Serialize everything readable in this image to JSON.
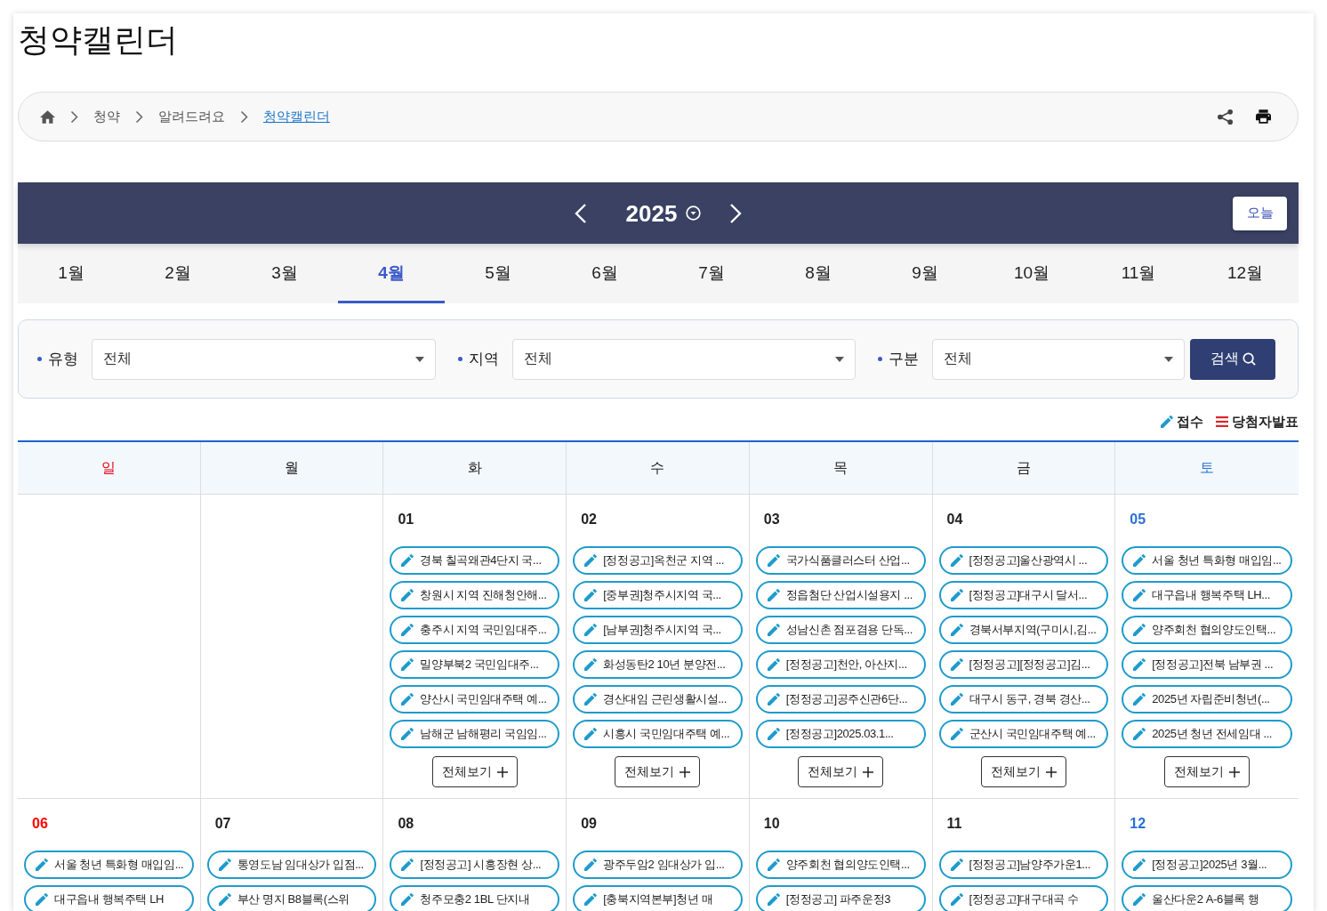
{
  "page_title": "청약캘린더",
  "breadcrumb": [
    {
      "label": "청약",
      "current": false
    },
    {
      "label": "알려드려요",
      "current": false
    },
    {
      "label": "청약캘린더",
      "current": true
    }
  ],
  "calendar_header": {
    "year": "2025",
    "today_button": "오늘"
  },
  "months": [
    {
      "label": "1월",
      "selected": false
    },
    {
      "label": "2월",
      "selected": false
    },
    {
      "label": "3월",
      "selected": false
    },
    {
      "label": "4월",
      "selected": true
    },
    {
      "label": "5월",
      "selected": false
    },
    {
      "label": "6월",
      "selected": false
    },
    {
      "label": "7월",
      "selected": false
    },
    {
      "label": "8월",
      "selected": false
    },
    {
      "label": "9월",
      "selected": false
    },
    {
      "label": "10월",
      "selected": false
    },
    {
      "label": "11월",
      "selected": false
    },
    {
      "label": "12월",
      "selected": false
    }
  ],
  "filters": [
    {
      "label": "유형",
      "value": "전체"
    },
    {
      "label": "지역",
      "value": "전체"
    },
    {
      "label": "구분",
      "value": "전체"
    }
  ],
  "search_button": "검색",
  "legend": [
    {
      "kind": "receipt",
      "label": "접수"
    },
    {
      "kind": "announcement",
      "label": "당첨자발표"
    }
  ],
  "weekdays": [
    {
      "label": "일",
      "kind": "sunday"
    },
    {
      "label": "월",
      "kind": "weekday"
    },
    {
      "label": "화",
      "kind": "weekday"
    },
    {
      "label": "수",
      "kind": "weekday"
    },
    {
      "label": "목",
      "kind": "weekday"
    },
    {
      "label": "금",
      "kind": "weekday"
    },
    {
      "label": "토",
      "kind": "saturday"
    }
  ],
  "weeks": [
    {
      "days": [
        {
          "kind": "empty"
        },
        {
          "kind": "empty"
        },
        {
          "date": "01",
          "kind": "weekday",
          "events": [
            {
              "kind": "receipt",
              "title": "경북 칠곡왜관4단지 국..."
            },
            {
              "kind": "receipt",
              "title": "창원시 지역 진해청안해..."
            },
            {
              "kind": "receipt",
              "title": "충주시 지역 국민임대주..."
            },
            {
              "kind": "receipt",
              "title": "밀양부북2 국민임대주..."
            },
            {
              "kind": "receipt",
              "title": "양산시 국민임대주택 예..."
            },
            {
              "kind": "receipt",
              "title": "남해군 남해평리 국임임..."
            }
          ],
          "more_button": "전체보기"
        },
        {
          "date": "02",
          "kind": "weekday",
          "events": [
            {
              "kind": "receipt",
              "title": "[정정공고]옥천군 지역 ..."
            },
            {
              "kind": "receipt",
              "title": "[중부권]청주시지역 국..."
            },
            {
              "kind": "receipt",
              "title": "[남부권]청주시지역 국..."
            },
            {
              "kind": "receipt",
              "title": "화성동탄2 10년 분양전..."
            },
            {
              "kind": "receipt",
              "title": "경산대임 근린생활시설..."
            },
            {
              "kind": "receipt",
              "title": "시흥시 국민임대주택 예..."
            }
          ],
          "more_button": "전체보기"
        },
        {
          "date": "03",
          "kind": "weekday",
          "events": [
            {
              "kind": "receipt",
              "title": "국가식품클러스터 산업..."
            },
            {
              "kind": "receipt",
              "title": "정읍첨단 산업시설용지 ..."
            },
            {
              "kind": "receipt",
              "title": "성남신촌 점포겸용 단독..."
            },
            {
              "kind": "receipt",
              "title": "[정정공고]천안, 아산지..."
            },
            {
              "kind": "receipt",
              "title": "[정정공고]공주신관6단..."
            },
            {
              "kind": "receipt",
              "title": "[정정공고]2025.03.1..."
            }
          ],
          "more_button": "전체보기"
        },
        {
          "date": "04",
          "kind": "weekday",
          "events": [
            {
              "kind": "receipt",
              "title": "[정정공고]울산광역시 ..."
            },
            {
              "kind": "receipt",
              "title": "[정정공고]대구시 달서..."
            },
            {
              "kind": "receipt",
              "title": "경북서부지역(구미시,김..."
            },
            {
              "kind": "receipt",
              "title": "[정정공고][정정공고]김..."
            },
            {
              "kind": "receipt",
              "title": "대구시 동구, 경북 경산..."
            },
            {
              "kind": "receipt",
              "title": "군산시 국민임대주택 예..."
            }
          ],
          "more_button": "전체보기"
        },
        {
          "date": "05",
          "kind": "saturday",
          "events": [
            {
              "kind": "receipt",
              "title": "서울 청년 특화형 매입임..."
            },
            {
              "kind": "receipt",
              "title": "대구읍내 행복주택 LH..."
            },
            {
              "kind": "receipt",
              "title": "양주회천 협의양도인택..."
            },
            {
              "kind": "receipt",
              "title": "[정정공고]전북 남부권 ..."
            },
            {
              "kind": "receipt",
              "title": "2025년 자립준비청년(..."
            },
            {
              "kind": "receipt",
              "title": "2025년 청년 전세임대 ..."
            }
          ],
          "more_button": "전체보기"
        }
      ]
    },
    {
      "days": [
        {
          "date": "06",
          "kind": "sunday",
          "events": [
            {
              "kind": "receipt",
              "title": "서울 청년 특화형 매입임..."
            },
            {
              "kind": "receipt",
              "title": "대구읍내 행복주택 LH"
            }
          ]
        },
        {
          "date": "07",
          "kind": "weekday",
          "events": [
            {
              "kind": "receipt",
              "title": "통영도남 임대상가 입점..."
            },
            {
              "kind": "receipt",
              "title": "부산 명지 B8블록(스위"
            }
          ]
        },
        {
          "date": "08",
          "kind": "weekday",
          "events": [
            {
              "kind": "receipt",
              "title": "[정정공고] 시흥장현 상..."
            },
            {
              "kind": "receipt",
              "title": "청주모충2 1BL 단지내"
            }
          ]
        },
        {
          "date": "09",
          "kind": "weekday",
          "events": [
            {
              "kind": "receipt",
              "title": "광주두암2 임대상가 입..."
            },
            {
              "kind": "receipt",
              "title": "[충북지역본부]청년 매"
            }
          ]
        },
        {
          "date": "10",
          "kind": "weekday",
          "events": [
            {
              "kind": "receipt",
              "title": "양주회천 협의양도인택..."
            },
            {
              "kind": "receipt",
              "title": "[정정공고] 파주운정3"
            }
          ]
        },
        {
          "date": "11",
          "kind": "weekday",
          "events": [
            {
              "kind": "receipt",
              "title": "[정정공고]남양주가운1..."
            },
            {
              "kind": "receipt",
              "title": "[정정공고]대구대곡 수"
            }
          ]
        },
        {
          "date": "12",
          "kind": "saturday",
          "events": [
            {
              "kind": "receipt",
              "title": "[정정공고]2025년 3월..."
            },
            {
              "kind": "receipt",
              "title": "울산다운2 A-6블록 행"
            }
          ]
        }
      ]
    }
  ]
}
